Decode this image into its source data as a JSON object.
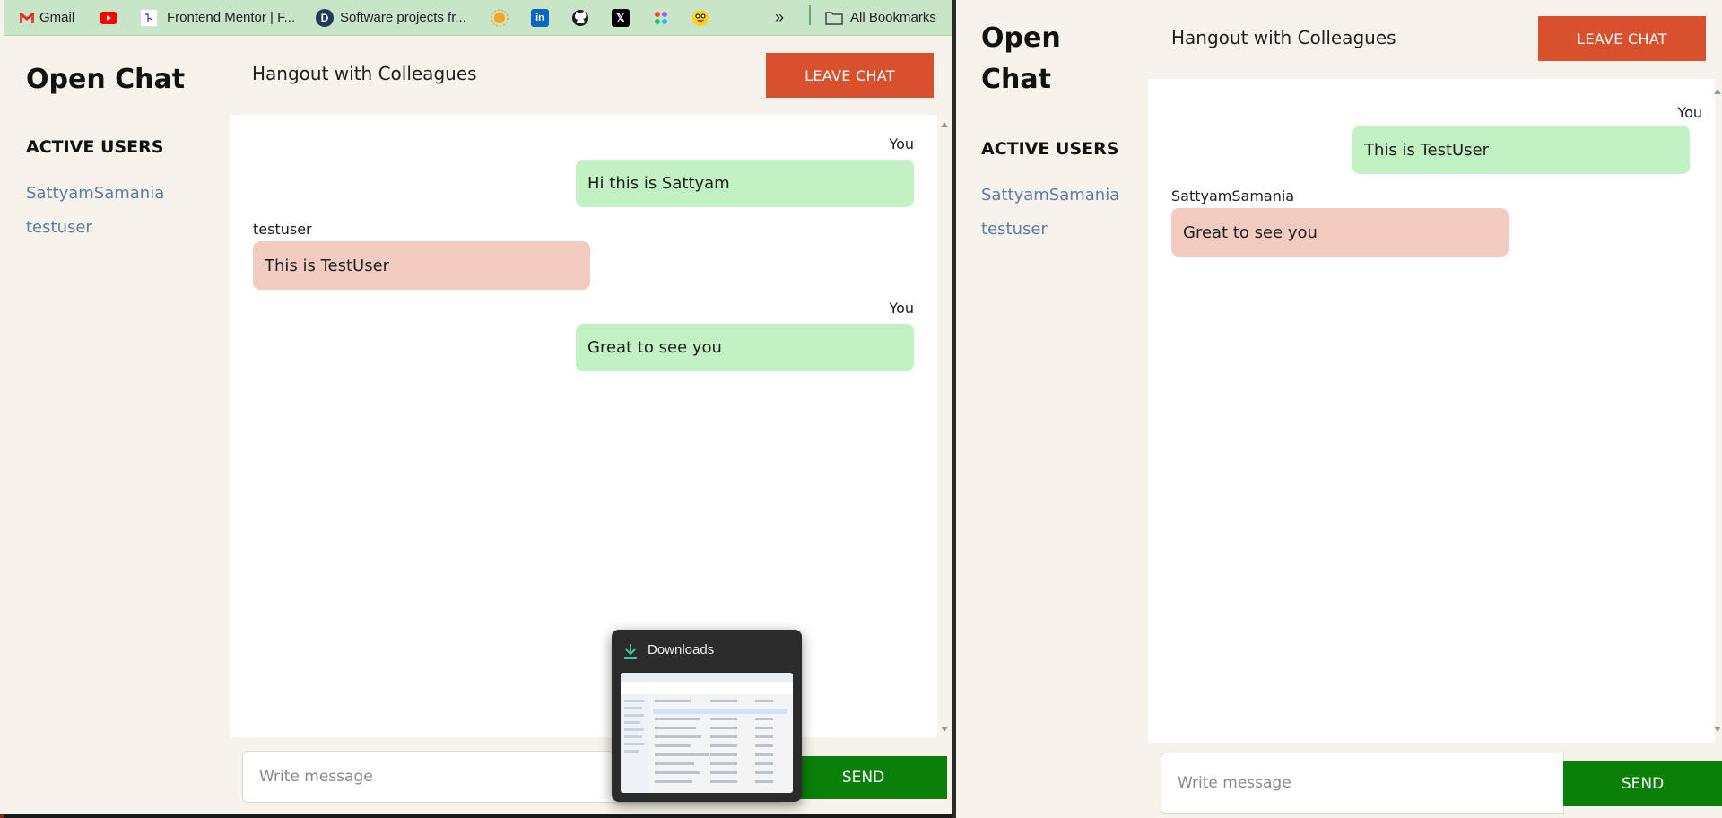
{
  "bookmarks_bar": {
    "items": [
      {
        "label": "Gmail",
        "icon": "gmail-icon"
      },
      {
        "label": "",
        "icon": "youtube-icon"
      },
      {
        "label": "Frontend Mentor | F...",
        "icon": "frontend-mentor-icon"
      },
      {
        "label": "Software projects fr...",
        "icon": "devprojects-icon"
      },
      {
        "label": "",
        "icon": "sun-icon"
      },
      {
        "label": "",
        "icon": "linkedin-icon"
      },
      {
        "label": "",
        "icon": "github-icon"
      },
      {
        "label": "",
        "icon": "x-icon"
      },
      {
        "label": "",
        "icon": "figma-icon"
      },
      {
        "label": "",
        "icon": "emoji-icon"
      }
    ],
    "overflow": "»",
    "all_bookmarks": "All Bookmarks"
  },
  "left_app": {
    "brand": "Open Chat",
    "active_users_title": "ACTIVE USERS",
    "users": [
      "SattyamSamania",
      "testuser"
    ],
    "room_name": "Hangout with Colleagues",
    "leave_label": "LEAVE CHAT",
    "messages": [
      {
        "author": "You",
        "text": "Hi this is Sattyam",
        "mine": true
      },
      {
        "author": "testuser",
        "text": "This is TestUser",
        "mine": false
      },
      {
        "author": "You",
        "text": "Great to see you",
        "mine": true
      }
    ],
    "input_placeholder": "Write message",
    "send_label": "SEND"
  },
  "downloads_popup": {
    "title": "Downloads",
    "icon": "download-icon"
  },
  "right_app": {
    "brand_line1": "Open",
    "brand_line2": "Chat",
    "active_users_title": "ACTIVE USERS",
    "users": [
      "SattyamSamania",
      "testuser"
    ],
    "room_name": "Hangout with Colleagues",
    "leave_label": "LEAVE CHAT",
    "messages": [
      {
        "author": "You",
        "text": "This is TestUser",
        "mine": true
      },
      {
        "author": "SattyamSamania",
        "text": "Great to see you",
        "mine": false
      }
    ],
    "input_placeholder": "Write message",
    "send_label": "SEND"
  },
  "colors": {
    "leave": "#d8502c",
    "send": "#0a8008",
    "mine_bubble": "#c2f2c3",
    "their_bubble": "#f3cbc1",
    "user_link": "#5a7ca8",
    "app_bg": "#f8f3ea"
  }
}
